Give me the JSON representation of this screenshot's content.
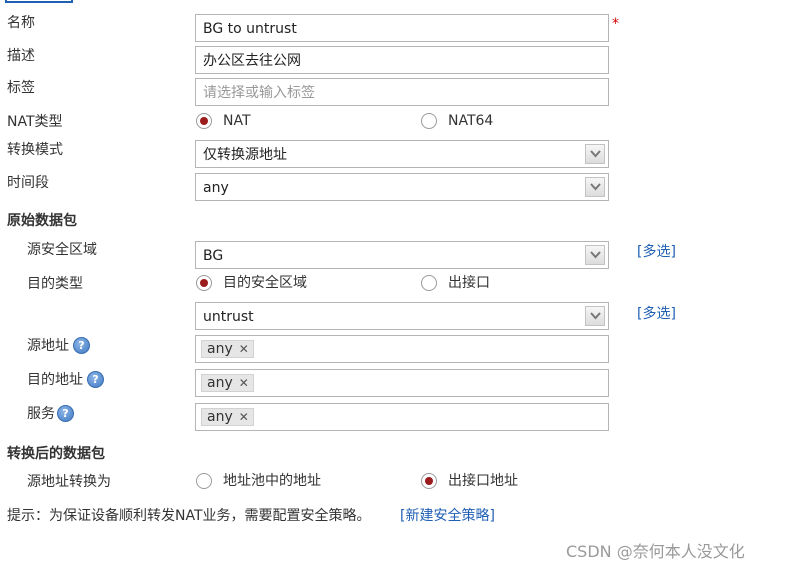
{
  "colors": {
    "accent": "#1f5fb4",
    "required": "#d00000",
    "radio_selected": "#9b1c1c"
  },
  "fields": {
    "name": {
      "label": "名称",
      "value": "BG to untrust",
      "required_mark": "*"
    },
    "description": {
      "label": "描述",
      "value": "办公区去往公网"
    },
    "tags": {
      "label": "标签",
      "placeholder": "请选择或输入标签"
    },
    "nat_type": {
      "label": "NAT类型",
      "options": [
        "NAT",
        "NAT64"
      ],
      "selected": "NAT"
    },
    "mode": {
      "label": "转换模式",
      "value": "仅转换源地址"
    },
    "time_range": {
      "label": "时间段",
      "value": "any"
    }
  },
  "original_packet": {
    "heading": "原始数据包",
    "src_zone": {
      "label": "源安全区域",
      "value": "BG",
      "multi_select": "[多选]"
    },
    "dest_type": {
      "label": "目的类型",
      "options": [
        "目的安全区域",
        "出接口"
      ],
      "selected": "目的安全区域"
    },
    "dest_zone": {
      "value": "untrust",
      "multi_select": "[多选]"
    },
    "src_address": {
      "label": "源地址",
      "tags": [
        "any"
      ]
    },
    "dest_address": {
      "label": "目的地址",
      "tags": [
        "any"
      ]
    },
    "service": {
      "label": "服务",
      "tags": [
        "any"
      ]
    }
  },
  "translated_packet": {
    "heading": "转换后的数据包",
    "src_translate": {
      "label": "源地址转换为",
      "options": [
        "地址池中的地址",
        "出接口地址"
      ],
      "selected": "出接口地址"
    }
  },
  "hint": {
    "text": "提示：为保证设备顺利转发NAT业务，需要配置安全策略。",
    "link": "[新建安全策略]"
  },
  "icons": {
    "help": "help-icon",
    "dropdown": "chevron-down-icon",
    "remove": "close-icon"
  },
  "watermark": "CSDN @奈何本人没文化"
}
